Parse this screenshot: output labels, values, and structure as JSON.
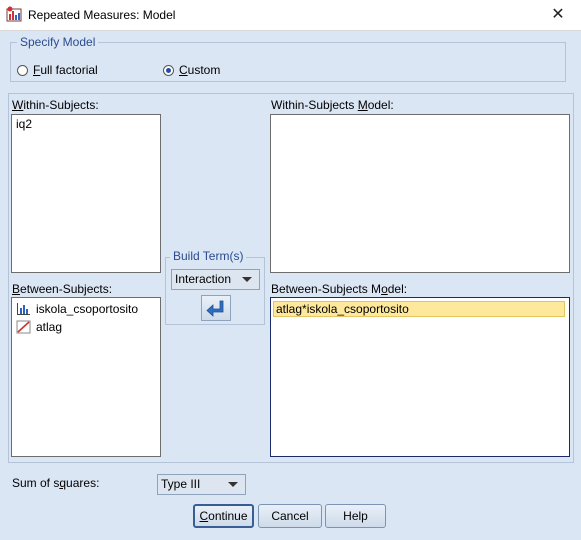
{
  "window": {
    "title": "Repeated Measures: Model",
    "close_glyph": "✕"
  },
  "specify_model": {
    "legend": "Specify Model",
    "full_factorial": {
      "mnemonic": "F",
      "rest": "ull factorial",
      "checked": false
    },
    "custom": {
      "mnemonic": "C",
      "rest": "ustom",
      "checked": true
    }
  },
  "within_subjects": {
    "mnemonic": "W",
    "rest": "ithin-Subjects:",
    "items": [
      "iq2"
    ]
  },
  "within_model": {
    "pre": "Within-Subjects ",
    "mnemonic": "M",
    "rest": "odel:"
  },
  "between_subjects": {
    "mnemonic": "B",
    "rest": "etween-Subjects:",
    "items": [
      {
        "label": "iskola_csoportosito",
        "icon": "bar-chart-icon"
      },
      {
        "label": "atlag",
        "icon": "scale-ruler-icon"
      }
    ]
  },
  "between_model": {
    "pre": "Between-Subjects M",
    "mnemonic": "o",
    "rest": "del:",
    "items": [
      "atlag*iskola_csoportosito"
    ]
  },
  "build_terms": {
    "legend": "Build Term(s)",
    "type": "Interaction",
    "arrow_icon": "move-arrow-icon"
  },
  "sum_of_squares": {
    "pre": "Sum of s",
    "mnemonic": "q",
    "rest": "uares:",
    "value": "Type III"
  },
  "buttons": {
    "continue": {
      "mnemonic": "C",
      "rest": "ontinue"
    },
    "cancel": "Cancel",
    "help": "Help"
  },
  "colors": {
    "background": "#dbe6f5",
    "highlight": "#fde89b",
    "legend_text": "#2a4b8d"
  }
}
